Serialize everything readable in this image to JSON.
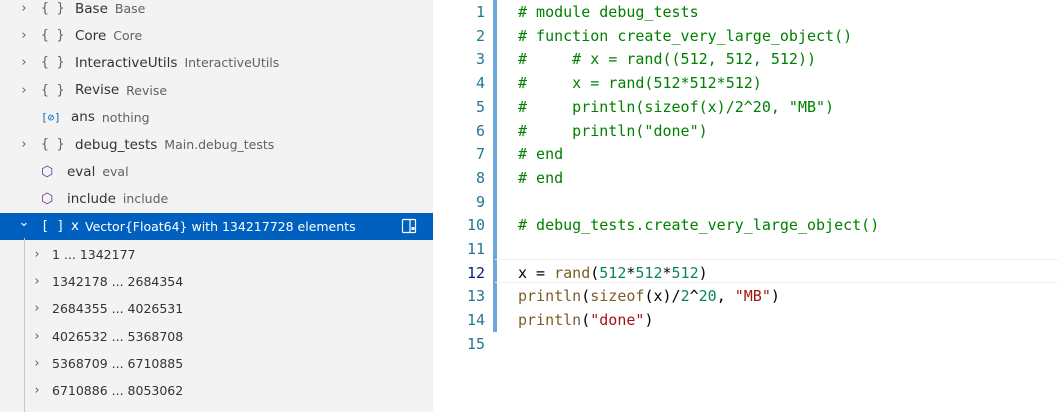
{
  "variables": [
    {
      "kind": "module",
      "icon": "{ }",
      "name": "Base",
      "value": "Base",
      "expandable": true
    },
    {
      "kind": "module",
      "icon": "{ }",
      "name": "Core",
      "value": "Core",
      "expandable": true
    },
    {
      "kind": "module",
      "icon": "{ }",
      "name": "InteractiveUtils",
      "value": "InteractiveUtils",
      "expandable": true
    },
    {
      "kind": "module",
      "icon": "{ }",
      "name": "Revise",
      "value": "Revise",
      "expandable": true
    },
    {
      "kind": "variable",
      "icon": "[⊘]",
      "name": "ans",
      "value": "nothing",
      "expandable": false
    },
    {
      "kind": "module",
      "icon": "{ }",
      "name": "debug_tests",
      "value": "Main.debug_tests",
      "expandable": true
    },
    {
      "kind": "function",
      "icon": "⬡",
      "name": "eval",
      "value": "eval",
      "expandable": false
    },
    {
      "kind": "function",
      "icon": "⬡",
      "name": "include",
      "value": "include",
      "expandable": false
    },
    {
      "kind": "array",
      "icon": "[ ]",
      "name": "x",
      "value": "Vector{Float64} with 134217728 elements",
      "expandable": true,
      "expanded": true,
      "selected": true
    }
  ],
  "array_children": [
    "1 ... 1342177",
    "1342178 ... 2684354",
    "2684355 ... 4026531",
    "4026532 ... 5368708",
    "5368709 ... 6710885",
    "6710886 ... 8053062"
  ],
  "editor": {
    "line_numbers": [
      "1",
      "2",
      "3",
      "4",
      "5",
      "6",
      "7",
      "8",
      "9",
      "10",
      "11",
      "12",
      "13",
      "14",
      "15"
    ],
    "active_line": "12",
    "lines": [
      "# module debug_tests",
      "# function create_very_large_object()",
      "#     # x = rand((512, 512, 512))",
      "#     x = rand(512*512*512)",
      "#     println(sizeof(x)/2^20, \"MB\")",
      "#     println(\"done\")",
      "# end",
      "# end",
      "",
      "# debug_tests.create_very_large_object()",
      "",
      "x = rand(512*512*512)",
      "println(sizeof(x)/2^20, \"MB\")",
      "println(\"done\")",
      ""
    ]
  },
  "colors": {
    "selection": "#0060c0",
    "comment": "#008000",
    "string": "#a31515",
    "number": "#098658",
    "line_number": "#237893"
  }
}
